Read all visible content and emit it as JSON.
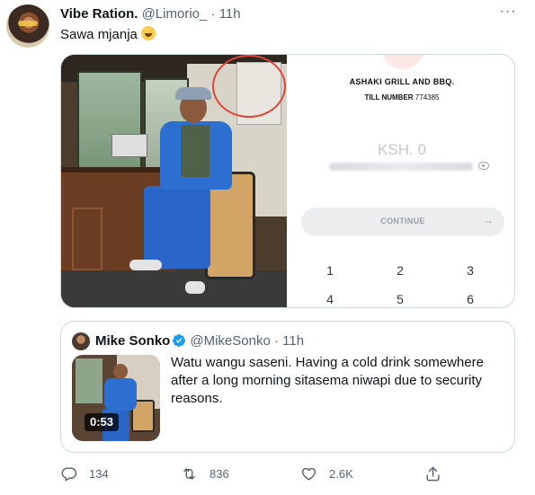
{
  "tweet": {
    "author_name": "Vibe Ration.",
    "handle": "@Limorio_",
    "separator": "·",
    "time": "11h",
    "more_label": "···",
    "text": "Sawa mjanja",
    "emoji": "face-with-tears-of-joy"
  },
  "payment_screen": {
    "merchant": "ASHAKI GRILL AND BBQ.",
    "till_label": "TILL NUMBER",
    "till_number": "774385",
    "amount": "KSH. 0",
    "continue_label": "CONTINUE",
    "continue_arrow": "→",
    "keypad": [
      "1",
      "2",
      "3",
      "4",
      "5",
      "6"
    ]
  },
  "quote": {
    "author_name": "Mike Sonko",
    "handle": "@MikeSonko",
    "separator": "·",
    "time": "11h",
    "verified": true,
    "video_duration": "0:53",
    "text": "Watu wangu saseni. Having a cold drink somewhere after a long morning sitasema niwapi due to security reasons."
  },
  "actions": {
    "replies": "134",
    "retweets": "836",
    "likes": "2.6K",
    "share_icon": "share-icon"
  },
  "colors": {
    "secondary_text": "#536471",
    "verified_blue": "#1d9bf0",
    "border": "#cfd9de",
    "highlight_circle": "#e0453a"
  }
}
